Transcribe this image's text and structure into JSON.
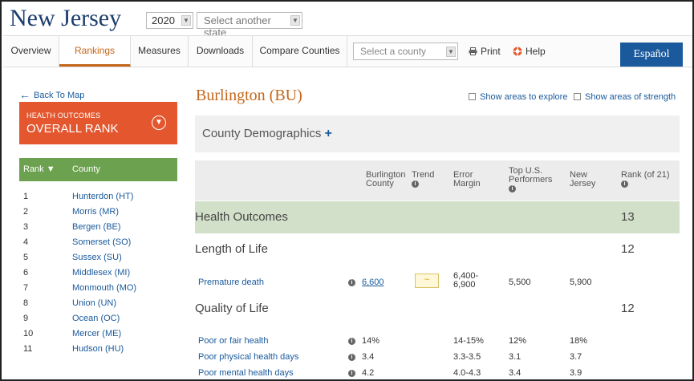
{
  "header": {
    "state": "New Jersey",
    "year": "2020",
    "state_select_placeholder": "Select another state"
  },
  "nav": {
    "tabs": [
      {
        "label": "Overview"
      },
      {
        "label": "Rankings"
      },
      {
        "label": "Measures"
      },
      {
        "label": "Downloads"
      },
      {
        "label": "Compare Counties"
      }
    ],
    "county_select_placeholder": "Select a county",
    "print_label": "Print",
    "help_label": "Help",
    "espanol_label": "Español"
  },
  "sidebar": {
    "back_label": "Back To Map",
    "outcomes_label": "HEALTH OUTCOMES",
    "overall_label": "OVERALL RANK",
    "rank_header": "Rank",
    "county_header": "County",
    "counties": [
      {
        "rank": "1",
        "name": "Hunterdon (HT)"
      },
      {
        "rank": "2",
        "name": "Morris (MR)"
      },
      {
        "rank": "3",
        "name": "Bergen (BE)"
      },
      {
        "rank": "4",
        "name": "Somerset (SO)"
      },
      {
        "rank": "5",
        "name": "Sussex (SU)"
      },
      {
        "rank": "6",
        "name": "Middlesex (MI)"
      },
      {
        "rank": "7",
        "name": "Monmouth (MO)"
      },
      {
        "rank": "8",
        "name": "Union (UN)"
      },
      {
        "rank": "9",
        "name": "Ocean (OC)"
      },
      {
        "rank": "10",
        "name": "Mercer (ME)"
      },
      {
        "rank": "11",
        "name": "Hudson (HU)"
      }
    ]
  },
  "main": {
    "county_title": "Burlington (BU)",
    "show_explore": "Show areas to explore",
    "show_strength": "Show areas of strength",
    "demographics_label": "County Demographics",
    "table_headers": {
      "county_l1": "Burlington",
      "county_l2": "County",
      "trend": "Trend",
      "error_l1": "Error",
      "error_l2": "Margin",
      "top_l1": "Top U.S.",
      "top_l2": "Performers",
      "state_l1": "New",
      "state_l2": "Jersey",
      "rank": "Rank (of 21)"
    },
    "sections": {
      "health_outcomes": {
        "label": "Health Outcomes",
        "rank": "13"
      },
      "length_of_life": {
        "label": "Length of Life",
        "rank": "12"
      },
      "quality_of_life": {
        "label": "Quality of Life",
        "rank": "12"
      }
    },
    "measures": {
      "premature_death": {
        "name": "Premature death",
        "value": "6,600",
        "error_l1": "6,400-",
        "error_l2": "6,900",
        "top": "5,500",
        "state": "5,900"
      },
      "poor_fair_health": {
        "name": "Poor or fair health",
        "value": "14%",
        "error": "14-15%",
        "top": "12%",
        "state": "18%"
      },
      "poor_physical": {
        "name": "Poor physical health days",
        "value": "3.4",
        "error": "3.3-3.5",
        "top": "3.1",
        "state": "3.7"
      },
      "poor_mental": {
        "name": "Poor mental health days",
        "value": "4.2",
        "error": "4.0-4.3",
        "top": "3.4",
        "state": "3.9"
      }
    }
  }
}
